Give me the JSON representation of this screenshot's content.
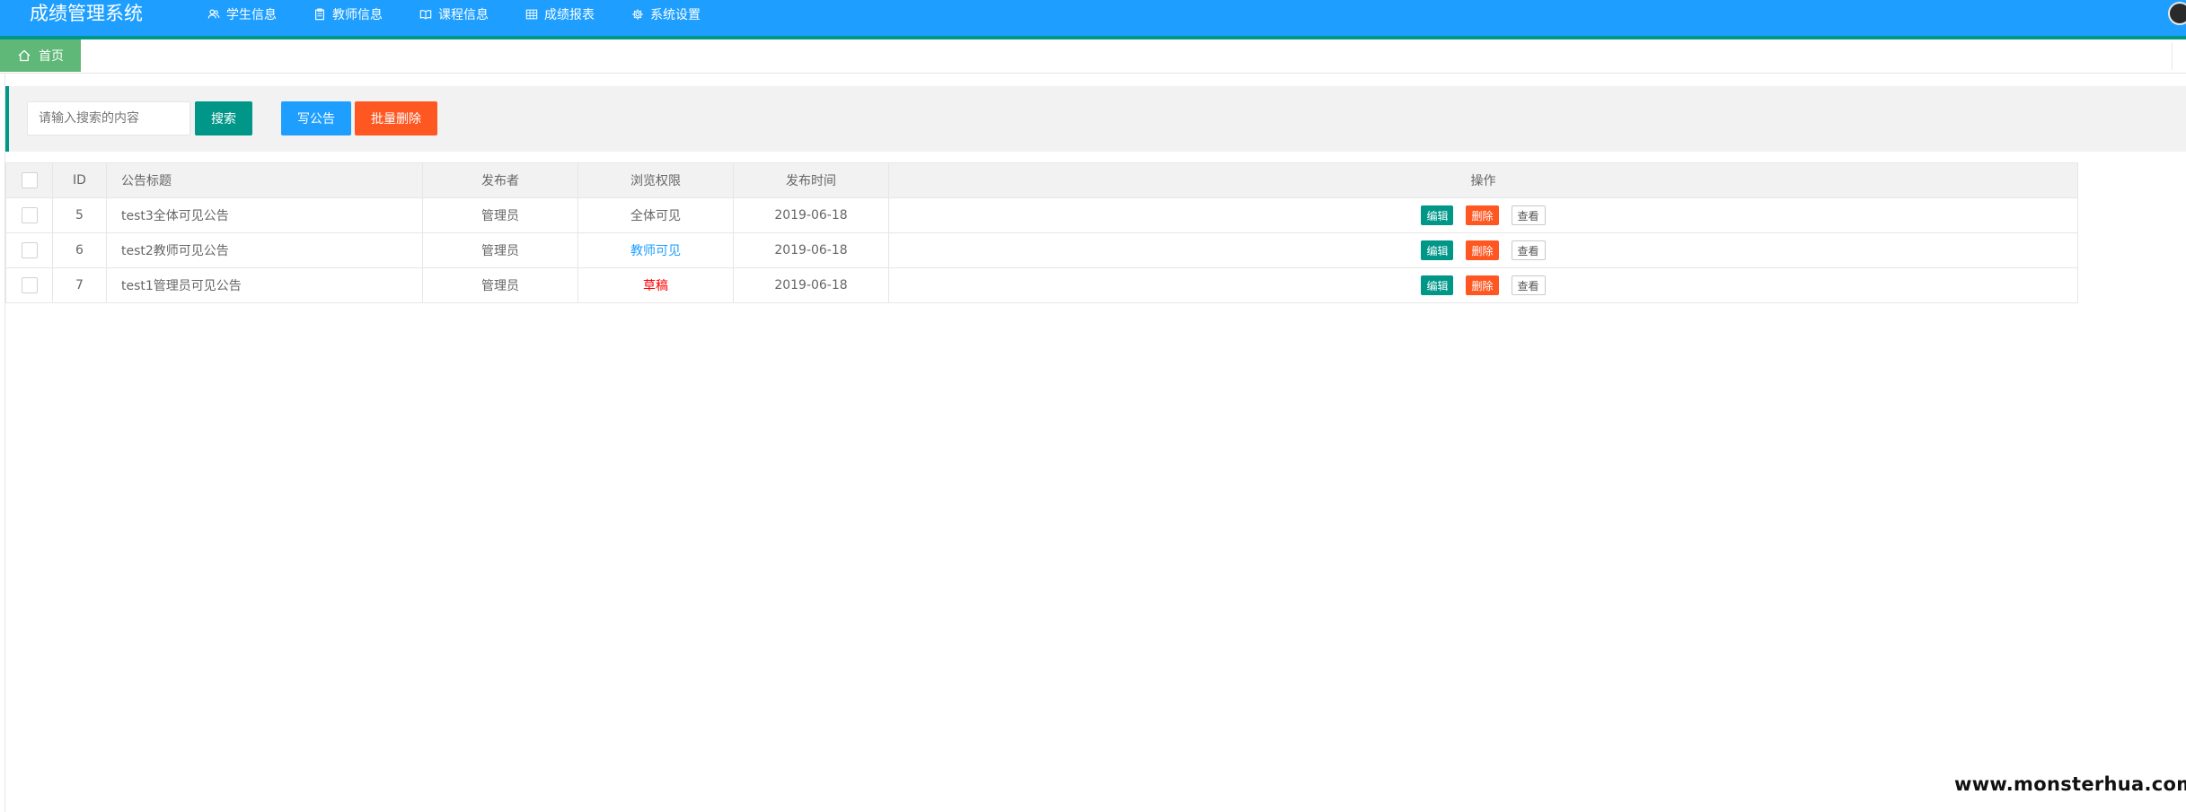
{
  "app": {
    "title": "成绩管理系统"
  },
  "nav": {
    "items": [
      {
        "label": "学生信息",
        "icon": "users-icon"
      },
      {
        "label": "教师信息",
        "icon": "clipboard-icon"
      },
      {
        "label": "课程信息",
        "icon": "book-icon"
      },
      {
        "label": "成绩报表",
        "icon": "table-icon"
      },
      {
        "label": "系统设置",
        "icon": "gear-icon"
      }
    ]
  },
  "tabs": {
    "home_label": "首页"
  },
  "toolbar": {
    "search_placeholder": "请输入搜索的内容",
    "search_label": "搜索",
    "write_label": "写公告",
    "batch_delete_label": "批量删除"
  },
  "table": {
    "columns": [
      "ID",
      "公告标题",
      "发布者",
      "浏览权限",
      "发布时间",
      "操作"
    ],
    "rows": [
      {
        "id": "5",
        "title": "test3全体可见公告",
        "publisher": "管理员",
        "permission": "全体可见",
        "date": "2019-06-18"
      },
      {
        "id": "6",
        "title": "test2教师可见公告",
        "publisher": "管理员",
        "permission": "教师可见",
        "date": "2019-06-18"
      },
      {
        "id": "7",
        "title": "test1管理员可见公告",
        "publisher": "管理员",
        "permission": "草稿",
        "date": "2019-06-18"
      }
    ],
    "actions": {
      "edit": "编辑",
      "delete": "删除",
      "view": "查看"
    }
  },
  "watermark": "www.monsterhua.com",
  "colors": {
    "header": "#1E9FFF",
    "accent": "#009688",
    "home_tab": "#5FB878",
    "danger": "#FF5722",
    "permission_teacher": "#1E9FFF",
    "permission_draft": "#FF0000"
  }
}
